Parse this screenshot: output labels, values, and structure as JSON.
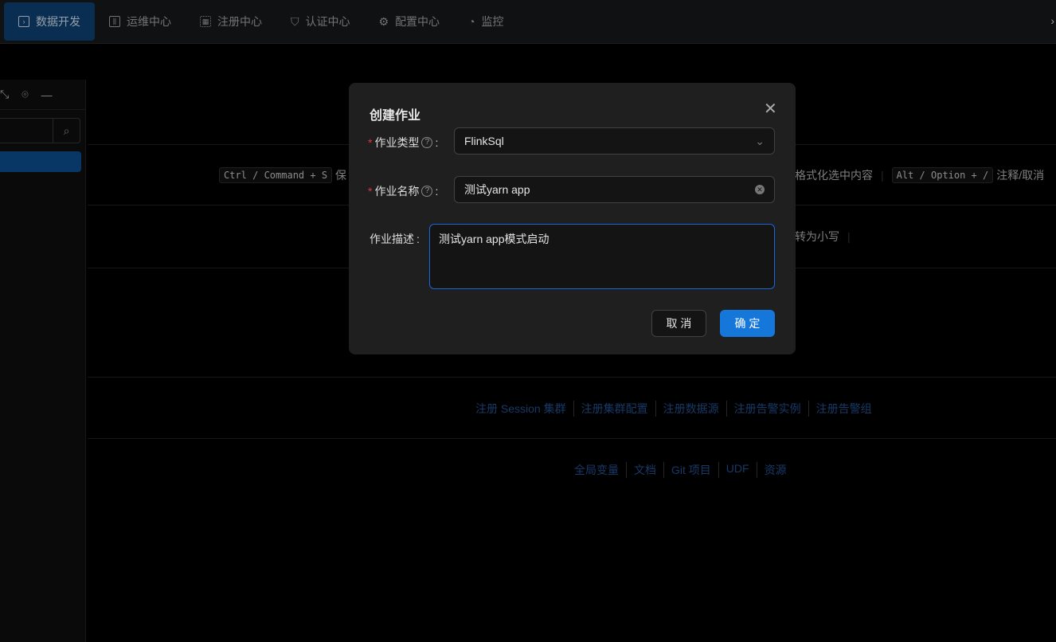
{
  "nav": {
    "tabs": [
      {
        "label": "数据开发",
        "icon": "terminal-icon",
        "active": true
      },
      {
        "label": "运维中心",
        "icon": "sliders-icon"
      },
      {
        "label": "注册中心",
        "icon": "grid-icon"
      },
      {
        "label": "认证中心",
        "icon": "shield-icon"
      },
      {
        "label": "配置中心",
        "icon": "gear-icon"
      },
      {
        "label": "监控",
        "icon": "dashboard-icon"
      }
    ]
  },
  "shortcuts": {
    "save_key": "Ctrl / Command + S",
    "save_text": "保",
    "format_text": "格式化选中内容",
    "comment_key": "Alt / Option + /",
    "comment_text": "注释/取消",
    "lower_text": "转为小写"
  },
  "links1": [
    "注册 Session 集群",
    "注册集群配置",
    "注册数据源",
    "注册告警实例",
    "注册告警组"
  ],
  "links2": [
    "全局变量",
    "文档",
    "Git 项目",
    "UDF",
    "资源"
  ],
  "modal": {
    "title": "创建作业",
    "type_label": "作业类型",
    "type_value": "FlinkSql",
    "name_label": "作业名称",
    "name_value": "测试yarn app",
    "desc_label": "作业描述",
    "desc_value": "测试yarn app模式启动",
    "cancel": "取 消",
    "ok": "确 定"
  },
  "colors": {
    "accent": "#1677db",
    "active_tab": "#0d3e6e"
  }
}
